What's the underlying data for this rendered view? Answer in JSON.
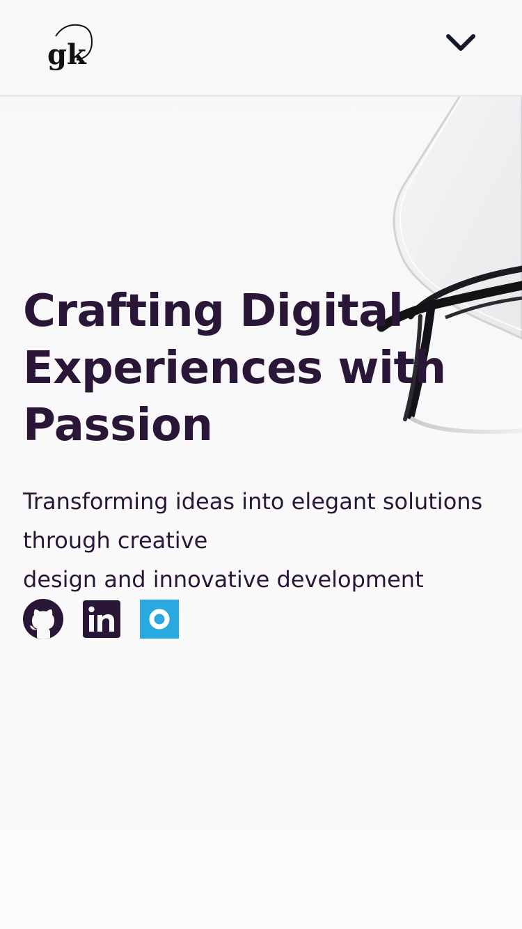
{
  "header": {
    "logo_text": "gk",
    "menu_icon": "chevron-down-icon"
  },
  "hero": {
    "title_lines": [
      "Crafting Digital",
      "Experiences with",
      "Passion"
    ],
    "subtitle_lines": [
      "Transforming ideas into elegant solutions",
      "through creative",
      "design and innovative development"
    ]
  },
  "social": [
    {
      "icon": "github-icon",
      "color": "#2a1636"
    },
    {
      "icon": "linkedin-icon",
      "color": "#2a1636"
    },
    {
      "icon": "ring-logo-icon",
      "color": "#29a9df"
    }
  ],
  "colors": {
    "text": "#2a1636",
    "accent": "#29a9df",
    "background": "#f8f8f9"
  }
}
